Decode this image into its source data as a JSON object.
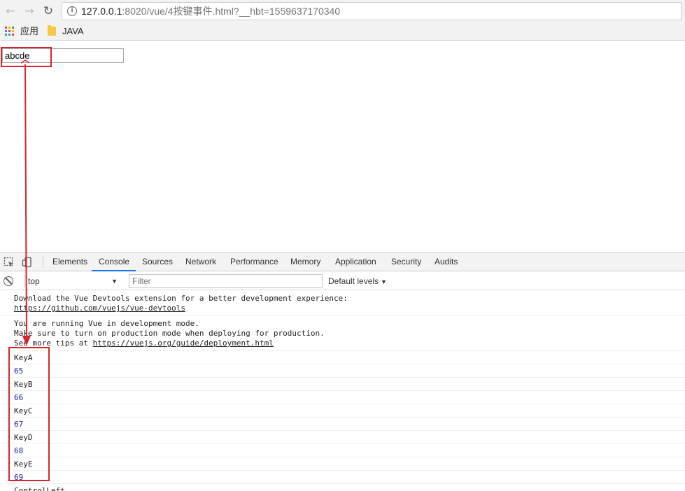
{
  "browser": {
    "url_host": "127.0.0.1",
    "url_rest": ":8020/vue/4按键事件.html?__hbt=1559637170340",
    "bookmarks": [
      {
        "label": "应用"
      },
      {
        "label": "JAVA"
      }
    ],
    "apps_colors": [
      "#ea4335",
      "#fbbc05",
      "#34a853",
      "#4285f4",
      "#ea4335",
      "#fbbc05",
      "#34a853",
      "#4285f4",
      "#ea4335"
    ]
  },
  "page": {
    "input_value": "abcde"
  },
  "devtools": {
    "tabs": [
      {
        "label": "Elements"
      },
      {
        "label": "Console"
      },
      {
        "label": "Sources"
      },
      {
        "label": "Network"
      },
      {
        "label": "Performance"
      },
      {
        "label": "Memory"
      },
      {
        "label": "Application"
      },
      {
        "label": "Security"
      },
      {
        "label": "Audits"
      }
    ],
    "active_tab": "Console",
    "context": "top",
    "filter_placeholder": "Filter",
    "levels": "Default levels",
    "messages": {
      "devtools_line1": "Download the Vue Devtools extension for a better development experience:",
      "devtools_link": "https://github.com/vuejs/vue-devtools",
      "devmode_line1": "You are running Vue in development mode.",
      "devmode_line2": "Make sure to turn on production mode when deploying for production.",
      "devmode_line3_prefix": "See more tips at ",
      "devmode_link": "https://vuejs.org/guide/deployment.html"
    },
    "key_log": [
      {
        "code": "KeyA",
        "keycode": "65"
      },
      {
        "code": "KeyB",
        "keycode": "66"
      },
      {
        "code": "KeyC",
        "keycode": "67"
      },
      {
        "code": "KeyD",
        "keycode": "68"
      },
      {
        "code": "KeyE",
        "keycode": "69"
      }
    ],
    "last_log": "ControlLeft"
  },
  "colors": {
    "annotation": "#d9232e",
    "number_log": "#1a1aa6",
    "active_tab": "#1a73e8"
  }
}
